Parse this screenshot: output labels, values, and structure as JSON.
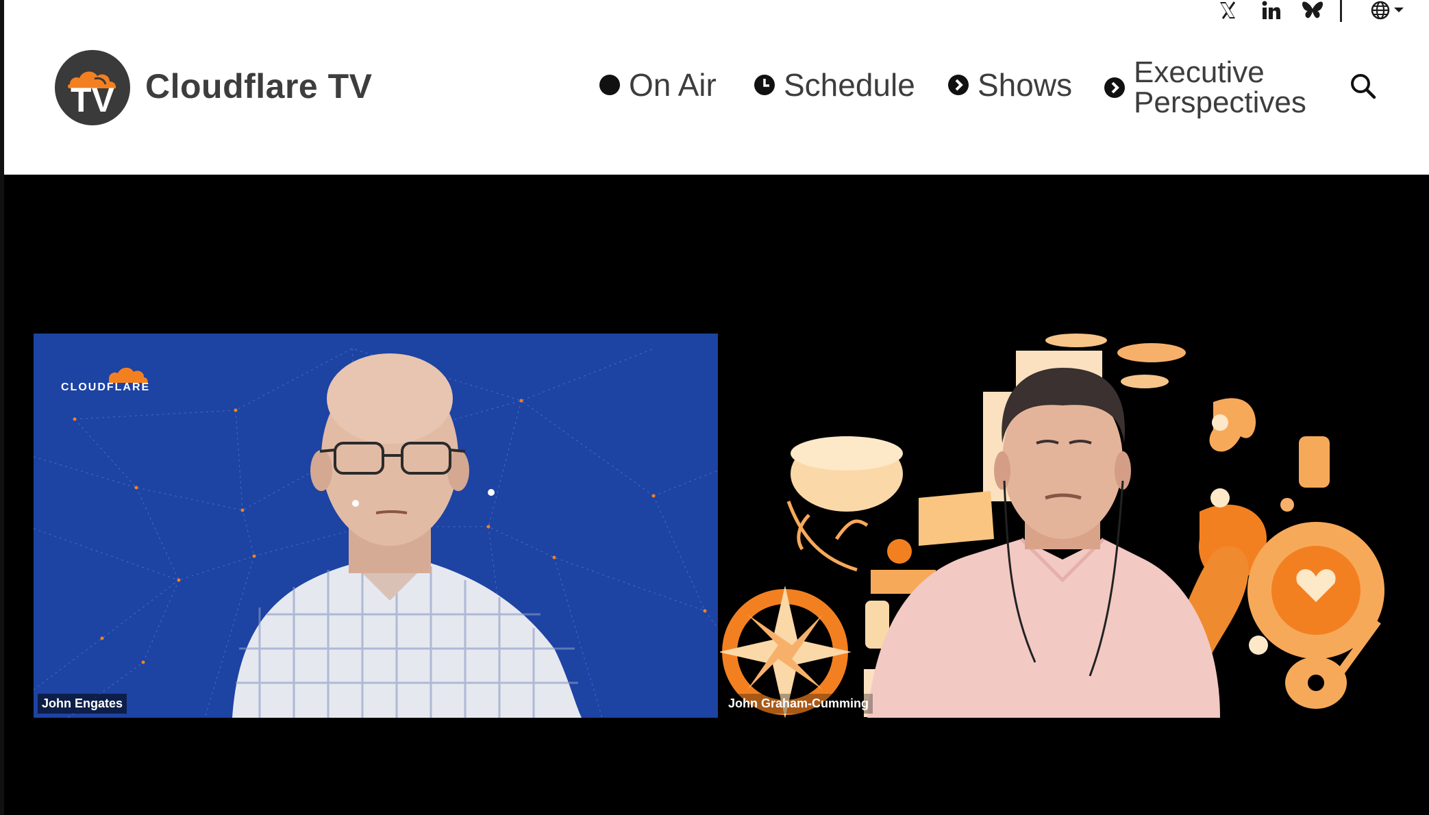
{
  "app": {
    "title": "Cloudflare TV",
    "logo_badge_text": "TV"
  },
  "header": {
    "social_icons": [
      "x-icon",
      "linkedin-icon",
      "bluesky-icon"
    ],
    "language_icon": "globe-icon",
    "nav": [
      {
        "label": "On Air",
        "icon": "live-dot-icon"
      },
      {
        "label": "Schedule",
        "icon": "clock-icon"
      },
      {
        "label": "Shows",
        "icon": "arrow-circle-icon"
      },
      {
        "label_line1": "Executive",
        "label_line2": "Perspectives",
        "icon": "arrow-circle-icon"
      }
    ],
    "search_icon": "search-icon"
  },
  "video": {
    "participants": [
      {
        "name": "John Engates",
        "background_logo": "CLOUDFLARE",
        "background_color": "#1d43a3"
      },
      {
        "name": "John Graham-Cumming",
        "background_color": "#000000"
      }
    ]
  },
  "colors": {
    "brand_orange": "#f38020",
    "header_text": "#3d3d3d",
    "logo_bg": "#3b3a3a"
  }
}
